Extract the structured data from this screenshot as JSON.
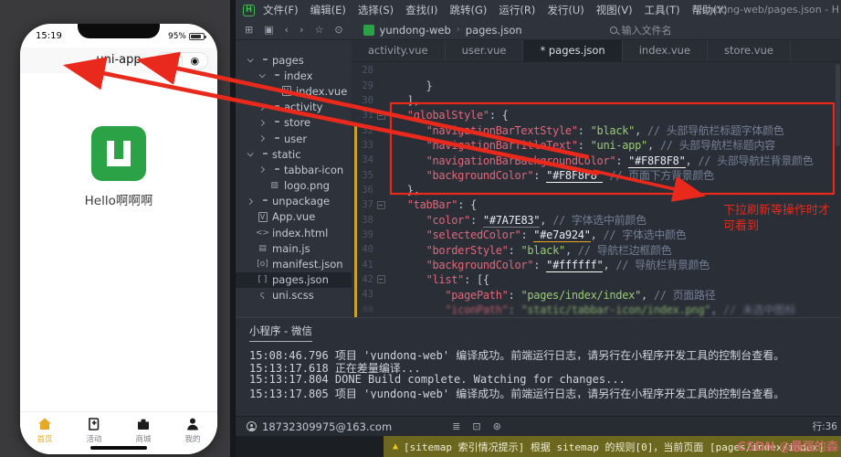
{
  "colors": {
    "accent_red": "#e8291c",
    "uniapp_green": "#2ba245",
    "tab_selected_yellow": "#e7a924",
    "tab_unselected_gray": "#7A7E83",
    "notif_olive": "#6c671e",
    "change_bar_yellow": "#c9a22b"
  },
  "phone": {
    "status_time": "15:19",
    "battery": "95%",
    "nav_title": "uni-app",
    "capsule_dots": "•••",
    "capsule_target": "◉",
    "hello_text": "Hello啊啊啊",
    "logo_icon": "uniapp-logo",
    "tabbar": [
      {
        "label": "首页",
        "icon": "home-icon",
        "selected": true
      },
      {
        "label": "活动",
        "icon": "activity-icon",
        "selected": false
      },
      {
        "label": "商城",
        "icon": "store-icon",
        "selected": false
      },
      {
        "label": "我的",
        "icon": "user-icon",
        "selected": false
      }
    ]
  },
  "window": {
    "logo": "hbuilderx-logo",
    "logo_letter": "H",
    "menus": [
      "文件(F)",
      "编辑(E)",
      "选择(S)",
      "查找(I)",
      "跳转(G)",
      "运行(R)",
      "发行(U)",
      "视图(V)",
      "工具(T)",
      "帮助(Y)"
    ],
    "title": "yundong-web/pages.json - H"
  },
  "toolbar": {
    "icons": [
      "new-file-icon",
      "save-icon",
      "back-icon",
      "forward-icon",
      "star-icon",
      "run-icon"
    ],
    "icon_glyphs": [
      "⊞",
      "▣",
      "‹",
      "›",
      "☆",
      "⊙"
    ],
    "breadcrumb": {
      "project": "yundong-web",
      "sep": "›",
      "file": "pages.json"
    },
    "search_placeholder": "输入文件名"
  },
  "tabs": [
    {
      "label": "activity.vue",
      "active": false
    },
    {
      "label": "user.vue",
      "active": false
    },
    {
      "label": "* pages.json",
      "active": true
    },
    {
      "label": "index.vue",
      "active": false
    },
    {
      "label": "store.vue",
      "active": false
    }
  ],
  "tree": [
    {
      "label": "pages",
      "indent": 0,
      "chevron": "down",
      "icon": "folder-open-icon"
    },
    {
      "label": "index",
      "indent": 1,
      "chevron": "down",
      "icon": "folder-open-icon"
    },
    {
      "label": "index.vue",
      "indent": 2,
      "chevron": null,
      "icon": "vue-file-icon"
    },
    {
      "label": "activity",
      "indent": 1,
      "chevron": "right",
      "icon": "folder-icon"
    },
    {
      "label": "store",
      "indent": 1,
      "chevron": "right",
      "icon": "folder-icon"
    },
    {
      "label": "user",
      "indent": 1,
      "chevron": "right",
      "icon": "folder-icon"
    },
    {
      "label": "static",
      "indent": 0,
      "chevron": "down",
      "icon": "folder-open-icon"
    },
    {
      "label": "tabbar-icon",
      "indent": 1,
      "chevron": "right",
      "icon": "folder-icon"
    },
    {
      "label": "logo.png",
      "indent": 1,
      "chevron": null,
      "icon": "image-file-icon"
    },
    {
      "label": "unpackage",
      "indent": 0,
      "chevron": "right",
      "icon": "folder-icon"
    },
    {
      "label": "App.vue",
      "indent": 0,
      "chevron": null,
      "icon": "vue-file-icon"
    },
    {
      "label": "index.html",
      "indent": 0,
      "chevron": null,
      "icon": "html-file-icon"
    },
    {
      "label": "main.js",
      "indent": 0,
      "chevron": null,
      "icon": "js-file-icon"
    },
    {
      "label": "manifest.json",
      "indent": 0,
      "chevron": null,
      "icon": "manifest-file-icon"
    },
    {
      "label": "pages.json",
      "indent": 0,
      "chevron": null,
      "icon": "json-file-icon",
      "selected": true
    },
    {
      "label": "uni.scss",
      "indent": 0,
      "chevron": null,
      "icon": "scss-file-icon"
    }
  ],
  "editor": {
    "lines": [
      {
        "n": 28,
        "fold": false,
        "tokens": []
      },
      {
        "n": 29,
        "fold": false,
        "tokens": [
          {
            "t": "      }",
            "c": "p"
          }
        ]
      },
      {
        "n": 30,
        "fold": false,
        "tokens": [
          {
            "t": "   ],",
            "c": "p"
          }
        ]
      },
      {
        "n": 31,
        "fold": true,
        "tokens": [
          {
            "t": "   ",
            "c": "p"
          },
          {
            "t": "\"globalStyle\"",
            "c": "k"
          },
          {
            "t": ": {",
            "c": "p"
          }
        ]
      },
      {
        "n": 32,
        "fold": false,
        "tokens": [
          {
            "t": "      ",
            "c": "p"
          },
          {
            "t": "\"navigationBarTextStyle\"",
            "c": "k"
          },
          {
            "t": ": ",
            "c": "p"
          },
          {
            "t": "\"black\"",
            "c": "s"
          },
          {
            "t": ", ",
            "c": "p"
          },
          {
            "t": "// 头部导航栏标题字体颜色",
            "c": "c"
          }
        ]
      },
      {
        "n": 33,
        "fold": false,
        "tokens": [
          {
            "t": "      ",
            "c": "p"
          },
          {
            "t": "\"navigationBarTitleText\"",
            "c": "k"
          },
          {
            "t": ": ",
            "c": "p"
          },
          {
            "t": "\"uni-app\"",
            "c": "s"
          },
          {
            "t": ", ",
            "c": "p"
          },
          {
            "t": "// 头部导航栏标题内容",
            "c": "c"
          }
        ]
      },
      {
        "n": 34,
        "fold": false,
        "tokens": [
          {
            "t": "      ",
            "c": "p"
          },
          {
            "t": "\"navigationBarBackgroundColor\"",
            "c": "k"
          },
          {
            "t": ": ",
            "c": "p"
          },
          {
            "t": "\"#F8F8F8\"",
            "c": "h",
            "u": "#F8F8F8"
          },
          {
            "t": ", ",
            "c": "p"
          },
          {
            "t": "// 头部导航栏背景颜色",
            "c": "c"
          }
        ]
      },
      {
        "n": 35,
        "fold": false,
        "tokens": [
          {
            "t": "      ",
            "c": "p"
          },
          {
            "t": "\"backgroundColor\"",
            "c": "k"
          },
          {
            "t": ": ",
            "c": "p"
          },
          {
            "t": "\"#F8F8F8\"",
            "c": "h",
            "u": "#F8F8F8"
          },
          {
            "t": " ",
            "c": "p"
          },
          {
            "t": "// 页面下方背景颜色",
            "c": "c"
          }
        ]
      },
      {
        "n": 36,
        "fold": false,
        "tokens": [
          {
            "t": "   },",
            "c": "p"
          }
        ]
      },
      {
        "n": 37,
        "fold": true,
        "tokens": [
          {
            "t": "   ",
            "c": "p"
          },
          {
            "t": "\"tabBar\"",
            "c": "k"
          },
          {
            "t": ": {",
            "c": "p"
          }
        ]
      },
      {
        "n": 38,
        "fold": false,
        "tokens": [
          {
            "t": "      ",
            "c": "p"
          },
          {
            "t": "\"color\"",
            "c": "k"
          },
          {
            "t": ": ",
            "c": "p"
          },
          {
            "t": "\"#7A7E83\"",
            "c": "h",
            "u": "#7A7E83"
          },
          {
            "t": ", ",
            "c": "p"
          },
          {
            "t": "// 字体选中前颜色",
            "c": "c"
          }
        ]
      },
      {
        "n": 39,
        "fold": false,
        "tokens": [
          {
            "t": "      ",
            "c": "p"
          },
          {
            "t": "\"selectedColor\"",
            "c": "k"
          },
          {
            "t": ": ",
            "c": "p"
          },
          {
            "t": "\"#e7a924\"",
            "c": "h",
            "u": "#e7a924"
          },
          {
            "t": ", ",
            "c": "p"
          },
          {
            "t": "// 字体选中颜色",
            "c": "c"
          }
        ]
      },
      {
        "n": 40,
        "fold": false,
        "tokens": [
          {
            "t": "      ",
            "c": "p"
          },
          {
            "t": "\"borderStyle\"",
            "c": "k"
          },
          {
            "t": ": ",
            "c": "p"
          },
          {
            "t": "\"black\"",
            "c": "s"
          },
          {
            "t": ", ",
            "c": "p"
          },
          {
            "t": "// 导航栏边框颜色",
            "c": "c"
          }
        ]
      },
      {
        "n": 41,
        "fold": false,
        "tokens": [
          {
            "t": "      ",
            "c": "p"
          },
          {
            "t": "\"backgroundColor\"",
            "c": "k"
          },
          {
            "t": ": ",
            "c": "p"
          },
          {
            "t": "\"#ffffff\"",
            "c": "h",
            "u": "#ffffff"
          },
          {
            "t": ", ",
            "c": "p"
          },
          {
            "t": "// 导航栏背景颜色",
            "c": "c"
          }
        ]
      },
      {
        "n": 42,
        "fold": true,
        "tokens": [
          {
            "t": "      ",
            "c": "p"
          },
          {
            "t": "\"list\"",
            "c": "k"
          },
          {
            "t": ": [{",
            "c": "p"
          }
        ]
      },
      {
        "n": 43,
        "fold": false,
        "tokens": [
          {
            "t": "         ",
            "c": "p"
          },
          {
            "t": "\"pagePath\"",
            "c": "k"
          },
          {
            "t": ": ",
            "c": "p"
          },
          {
            "t": "\"pages/index/index\"",
            "c": "s"
          },
          {
            "t": ", ",
            "c": "p"
          },
          {
            "t": "// 页面路径",
            "c": "c"
          }
        ]
      },
      {
        "n": 44,
        "fold": false,
        "blurred": true,
        "tokens": [
          {
            "t": "         ",
            "c": "p"
          },
          {
            "t": "\"iconPath\"",
            "c": "k"
          },
          {
            "t": ": ",
            "c": "p"
          },
          {
            "t": "\"static/tabbar-icon/index.png\"",
            "c": "s"
          },
          {
            "t": ", ",
            "c": "p"
          },
          {
            "t": "// 未选中图标",
            "c": "c"
          }
        ]
      }
    ]
  },
  "console": {
    "tab": "小程序 - 微信",
    "lines": [
      "15:08:46.796 项目 'yundong-web' 编译成功。前端运行日志，请另行在小程序开发工具的控制台查看。",
      "15:13:17.618 正在差量编译...",
      "15:13:17.804  DONE  Build complete. Watching for changes...",
      "15:13:17.805 项目 'yundong-web' 编译成功。前端运行日志，请另行在小程序开发工具的控制台查看。"
    ]
  },
  "statusbar": {
    "account": "18732309975@163.com",
    "icons": [
      "list-icon",
      "panel-icon",
      "globe-icon"
    ],
    "icon_glyphs": [
      "≣",
      "⊡",
      "⊛"
    ],
    "line_info": "行:36"
  },
  "notification": {
    "warning_icon": "▲",
    "text": "[sitemap 索引情况提示] 根据 sitemap 的规则[0]，当前页面 [pages/index/index]"
  },
  "annotation": {
    "line1": "下拉刷新等操作时才",
    "line2": "可看到"
  },
  "watermark": "CSDN @最强的森"
}
